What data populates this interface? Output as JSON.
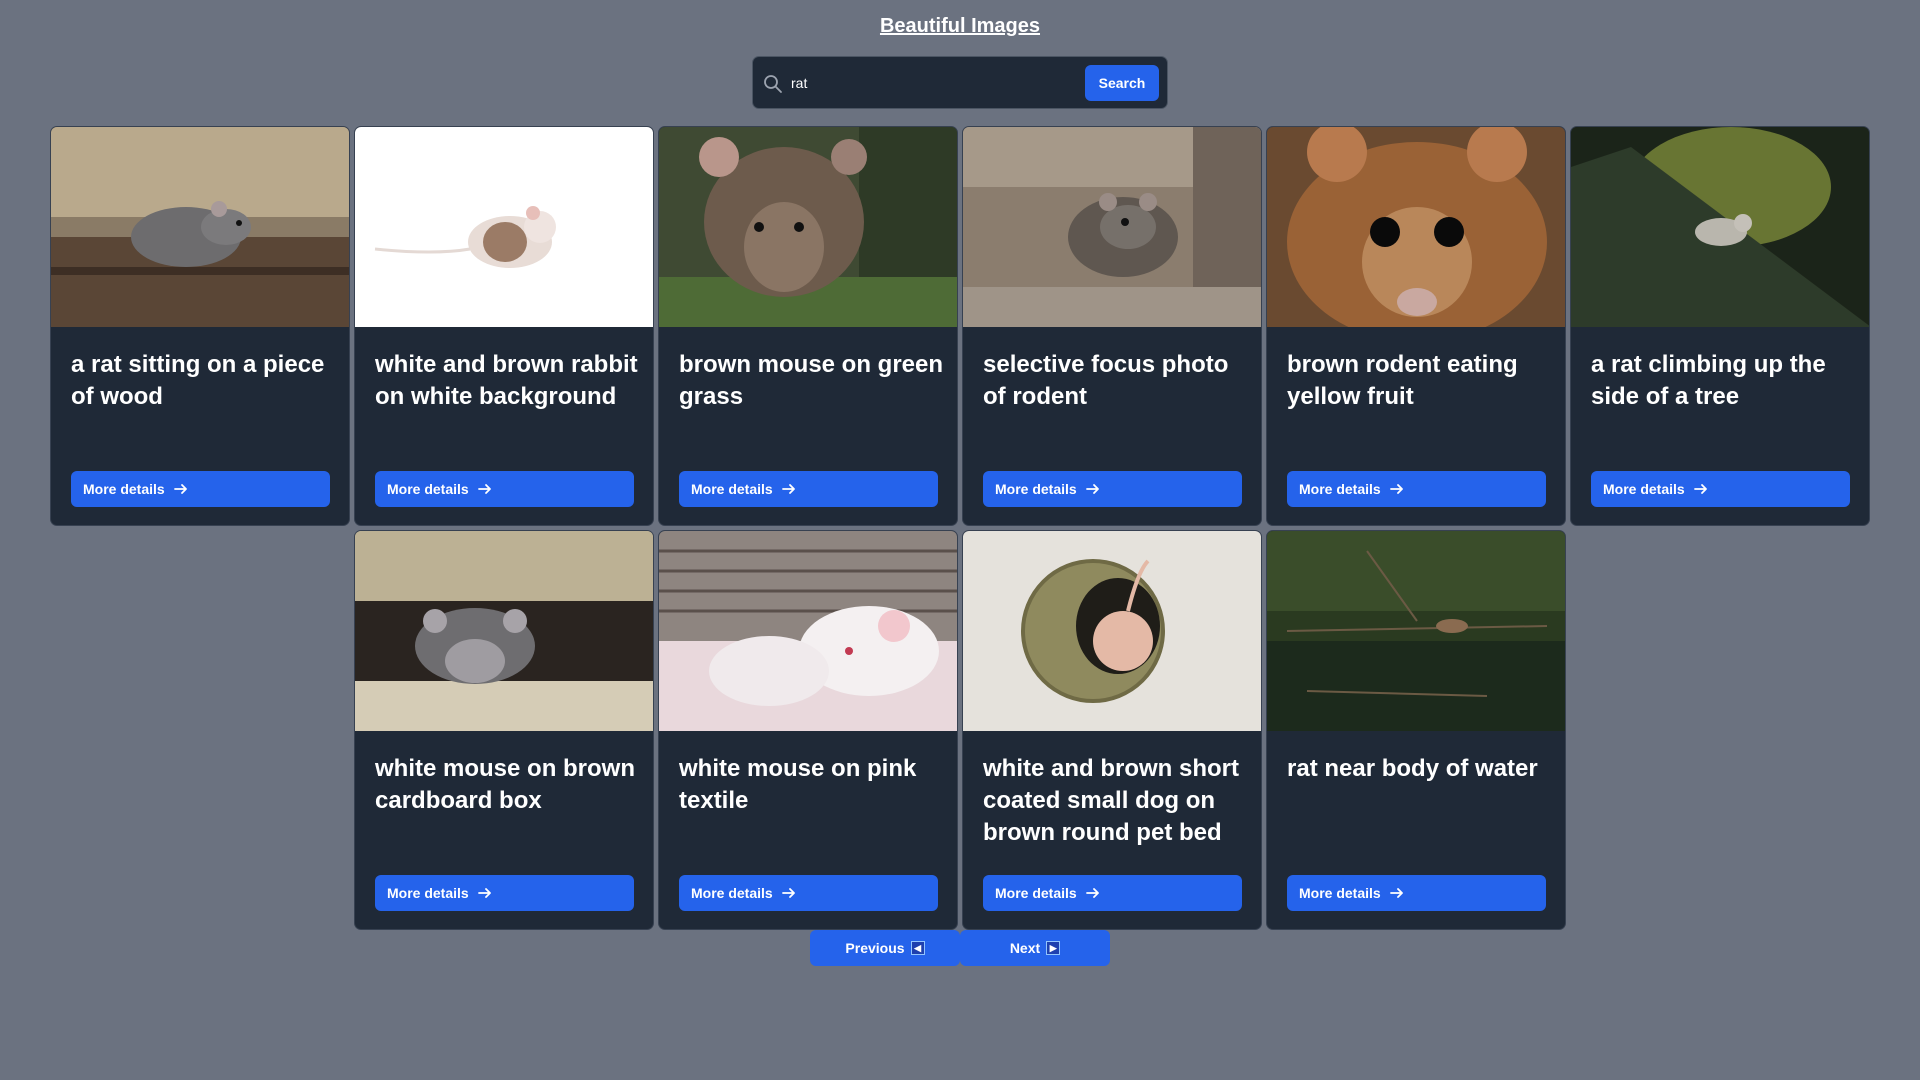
{
  "header": {
    "title": "Beautiful Images"
  },
  "search": {
    "value": "rat",
    "placeholder": "Search",
    "button_label": "Search"
  },
  "cards": [
    {
      "title": "a rat sitting on a piece of wood",
      "button_label": "More details"
    },
    {
      "title": "white and brown rabbit on white background",
      "button_label": "More details"
    },
    {
      "title": "brown mouse on green grass",
      "button_label": "More details"
    },
    {
      "title": "selective focus photo of rodent",
      "button_label": "More details"
    },
    {
      "title": "brown rodent eating yellow fruit",
      "button_label": "More details"
    },
    {
      "title": "a rat climbing up the side of a tree",
      "button_label": "More details"
    },
    {
      "title": "white mouse on brown cardboard box",
      "button_label": "More details"
    },
    {
      "title": "white mouse on pink textile",
      "button_label": "More details"
    },
    {
      "title": "white and brown short coated small dog on brown round pet bed",
      "button_label": "More details"
    },
    {
      "title": "rat near body of water",
      "button_label": "More details"
    }
  ],
  "pagination": {
    "previous_label": "Previous",
    "next_label": "Next"
  },
  "colors": {
    "background": "#6b7280",
    "card": "#1f2937",
    "accent": "#2563eb"
  }
}
